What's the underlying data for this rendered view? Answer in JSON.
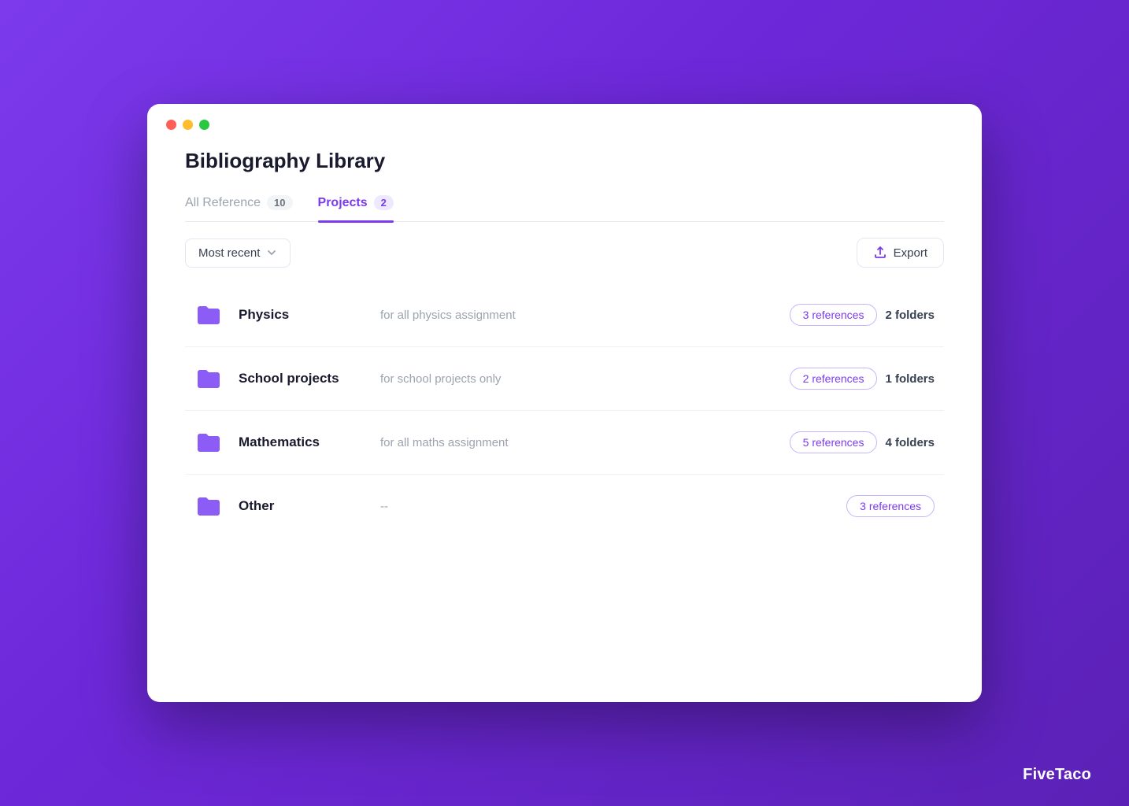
{
  "window": {
    "title": "Bibliography Library"
  },
  "tabs": [
    {
      "id": "all-reference",
      "label": "All Reference",
      "count": "10",
      "active": false
    },
    {
      "id": "projects",
      "label": "Projects",
      "count": "2",
      "active": true
    }
  ],
  "toolbar": {
    "sort_label": "Most recent",
    "export_label": "Export"
  },
  "projects": [
    {
      "name": "Physics",
      "description": "for all physics assignment",
      "references": "3 references",
      "folders": "2 folders"
    },
    {
      "name": "School projects",
      "description": "for school projects only",
      "references": "2 references",
      "folders": "1 folders"
    },
    {
      "name": "Mathematics",
      "description": "for all maths assignment",
      "references": "5 references",
      "folders": "4 folders"
    },
    {
      "name": "Other",
      "description": "--",
      "references": "3 references",
      "folders": null
    }
  ],
  "branding": "FiveTaco",
  "colors": {
    "purple": "#7c3aed",
    "purple_light": "#ede9fe",
    "border": "#c4b5fd"
  }
}
